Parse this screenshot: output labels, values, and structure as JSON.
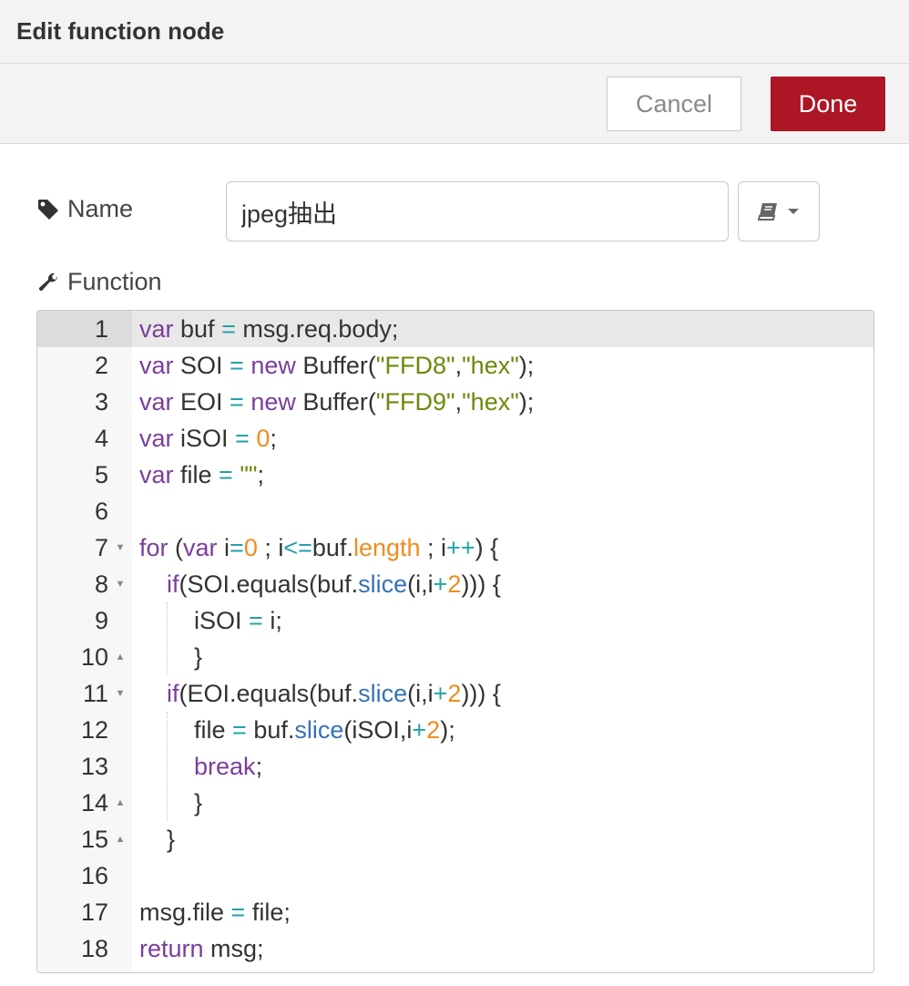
{
  "dialog": {
    "title": "Edit function node",
    "cancel_label": "Cancel",
    "done_label": "Done",
    "accent_color": "#ad1625"
  },
  "form": {
    "name_label": "Name",
    "name_value": "jpeg抽出",
    "name_icon": "tag-icon",
    "library_icon": "book-icon",
    "function_label": "Function",
    "function_icon": "wrench-icon"
  },
  "editor": {
    "active_line": 1,
    "lines": [
      {
        "num": "1",
        "fold": "",
        "tokens": [
          [
            "kw",
            "var"
          ],
          [
            "t",
            " buf "
          ],
          [
            "op",
            "="
          ],
          [
            "t",
            " msg.req.body;"
          ]
        ]
      },
      {
        "num": "2",
        "fold": "",
        "tokens": [
          [
            "kw",
            "var"
          ],
          [
            "t",
            " SOI "
          ],
          [
            "op",
            "="
          ],
          [
            "t",
            " "
          ],
          [
            "kw",
            "new"
          ],
          [
            "t",
            " Buffer("
          ],
          [
            "str",
            "\"FFD8\""
          ],
          [
            "t",
            ","
          ],
          [
            "str",
            "\"hex\""
          ],
          [
            "t",
            ");"
          ]
        ]
      },
      {
        "num": "3",
        "fold": "",
        "tokens": [
          [
            "kw",
            "var"
          ],
          [
            "t",
            " EOI "
          ],
          [
            "op",
            "="
          ],
          [
            "t",
            " "
          ],
          [
            "kw",
            "new"
          ],
          [
            "t",
            " Buffer("
          ],
          [
            "str",
            "\"FFD9\""
          ],
          [
            "t",
            ","
          ],
          [
            "str",
            "\"hex\""
          ],
          [
            "t",
            ");"
          ]
        ]
      },
      {
        "num": "4",
        "fold": "",
        "tokens": [
          [
            "kw",
            "var"
          ],
          [
            "t",
            " iSOI "
          ],
          [
            "op",
            "="
          ],
          [
            "t",
            " "
          ],
          [
            "num",
            "0"
          ],
          [
            "t",
            ";"
          ]
        ]
      },
      {
        "num": "5",
        "fold": "",
        "tokens": [
          [
            "kw",
            "var"
          ],
          [
            "t",
            " file "
          ],
          [
            "op",
            "="
          ],
          [
            "t",
            " "
          ],
          [
            "str",
            "\"\""
          ],
          [
            "t",
            ";"
          ]
        ]
      },
      {
        "num": "6",
        "fold": "",
        "tokens": []
      },
      {
        "num": "7",
        "fold": "▼",
        "tokens": [
          [
            "kw",
            "for"
          ],
          [
            "t",
            " ("
          ],
          [
            "kw",
            "var"
          ],
          [
            "t",
            " i"
          ],
          [
            "op",
            "="
          ],
          [
            "num",
            "0"
          ],
          [
            "t",
            " ; i"
          ],
          [
            "op",
            "<="
          ],
          [
            "t",
            "buf."
          ],
          [
            "prop",
            "length"
          ],
          [
            "t",
            " ; i"
          ],
          [
            "op",
            "++"
          ],
          [
            "t",
            ") {"
          ]
        ]
      },
      {
        "num": "8",
        "fold": "▼",
        "tokens": [
          [
            "t",
            "    "
          ],
          [
            "kw",
            "if"
          ],
          [
            "t",
            "(SOI.equals(buf."
          ],
          [
            "fn",
            "slice"
          ],
          [
            "t",
            "(i,i"
          ],
          [
            "op",
            "+"
          ],
          [
            "num",
            "2"
          ],
          [
            "t",
            "))) {"
          ]
        ]
      },
      {
        "num": "9",
        "fold": "",
        "tokens": [
          [
            "t",
            "        iSOI "
          ],
          [
            "op",
            "="
          ],
          [
            "t",
            " i;"
          ]
        ]
      },
      {
        "num": "10",
        "fold": "▲",
        "tokens": [
          [
            "t",
            "        }"
          ]
        ]
      },
      {
        "num": "11",
        "fold": "▼",
        "tokens": [
          [
            "t",
            "    "
          ],
          [
            "kw",
            "if"
          ],
          [
            "t",
            "(EOI.equals(buf."
          ],
          [
            "fn",
            "slice"
          ],
          [
            "t",
            "(i,i"
          ],
          [
            "op",
            "+"
          ],
          [
            "num",
            "2"
          ],
          [
            "t",
            "))) {"
          ]
        ]
      },
      {
        "num": "12",
        "fold": "",
        "tokens": [
          [
            "t",
            "        file "
          ],
          [
            "op",
            "="
          ],
          [
            "t",
            " buf."
          ],
          [
            "fn",
            "slice"
          ],
          [
            "t",
            "(iSOI,i"
          ],
          [
            "op",
            "+"
          ],
          [
            "num",
            "2"
          ],
          [
            "t",
            ");"
          ]
        ]
      },
      {
        "num": "13",
        "fold": "",
        "tokens": [
          [
            "t",
            "        "
          ],
          [
            "kw",
            "break"
          ],
          [
            "t",
            ";"
          ]
        ]
      },
      {
        "num": "14",
        "fold": "▲",
        "tokens": [
          [
            "t",
            "        }"
          ]
        ]
      },
      {
        "num": "15",
        "fold": "▲",
        "tokens": [
          [
            "t",
            "    }"
          ]
        ]
      },
      {
        "num": "16",
        "fold": "",
        "tokens": []
      },
      {
        "num": "17",
        "fold": "",
        "tokens": [
          [
            "t",
            "msg.file "
          ],
          [
            "op",
            "="
          ],
          [
            "t",
            " file;"
          ]
        ]
      },
      {
        "num": "18",
        "fold": "",
        "tokens": [
          [
            "kw",
            "return"
          ],
          [
            "t",
            " msg;"
          ]
        ]
      }
    ]
  }
}
